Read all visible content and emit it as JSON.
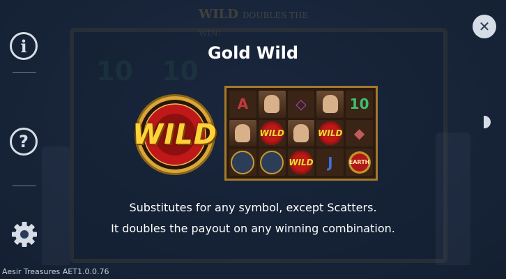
{
  "background": {
    "title_wild": "WILD",
    "title_text": "DOUBLES THE WIN!"
  },
  "menu": {
    "info_icon": "info-icon",
    "help_icon": "question-icon",
    "settings_icon": "gear-icon",
    "info_label": "i",
    "help_label": "?"
  },
  "close": {
    "icon": "close-icon",
    "label": "✕"
  },
  "panel": {
    "title": "Gold Wild",
    "wild_label": "WILD",
    "description_line1": "Substitutes for any symbol, except Scatters.",
    "description_line2": "It doubles the payout on any winning combination."
  },
  "preview": {
    "cells": [
      {
        "type": "letter",
        "label": "A",
        "color": "#c23a3a"
      },
      {
        "type": "face"
      },
      {
        "type": "letter",
        "label": "◇",
        "color": "#a344c2"
      },
      {
        "type": "face"
      },
      {
        "type": "letter",
        "label": "10",
        "color": "#3fbf6f"
      },
      {
        "type": "face"
      },
      {
        "type": "wild",
        "label": "WILD"
      },
      {
        "type": "face"
      },
      {
        "type": "wild",
        "label": "WILD"
      },
      {
        "type": "letter",
        "label": "◆",
        "color": "#c25b5b"
      },
      {
        "type": "round"
      },
      {
        "type": "round"
      },
      {
        "type": "wild",
        "label": "WILD"
      },
      {
        "type": "letter",
        "label": "J",
        "color": "#3f6fd6"
      },
      {
        "type": "scatter",
        "label": "EARTH"
      }
    ]
  },
  "footer": {
    "version": "Aesir Treasures AET1.0.0.76"
  },
  "colors": {
    "accent": "#c99a2e",
    "wild_red": "#c01818",
    "wild_gold": "#ffd23a"
  }
}
